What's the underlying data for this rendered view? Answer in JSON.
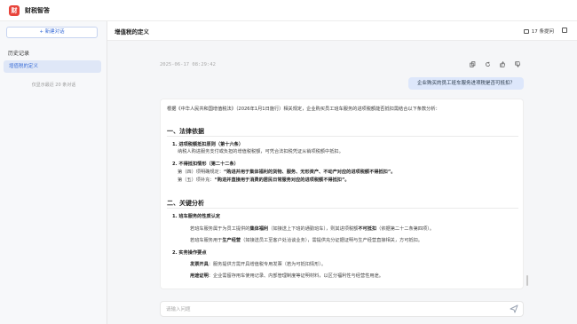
{
  "app": {
    "logo_text": "财",
    "title": "财税智答"
  },
  "sidebar": {
    "new_chat_label": "+ 新建对话",
    "history_title": "历史记录",
    "items": [
      {
        "label": "增值税的定义"
      }
    ],
    "history_note": "仅显示最近 20 条对话"
  },
  "header": {
    "title": "增值税的定义",
    "message_count": "17 条提问"
  },
  "chat": {
    "timestamp": "2025-06-17 08:29:42",
    "user_question": "企业购买的员工班车服务进项税是否可抵扣？",
    "answer": {
      "intro": "根据《中华人民共和国增值税法》（2026年1月1日施行）相关规定，企业购买员工班车服务的进项税额能否抵扣需结合以下条款分析：",
      "section1_title": "一、法律依据",
      "s1_item1_title": "1. 进项税额抵扣原则（第十六条）",
      "s1_item1_text": "纳税人购进服务支付或负担的增值税税额，可凭合法扣税凭证从销项税额中抵扣。",
      "s1_item2_title": "2. 不得抵扣情形（第二十二条）",
      "s1_item2_line1_pre": "第（四）项明确规定：",
      "s1_item2_line1_bold": "“购进并用于集体福利的货物、服务、无形资产、不动产对应的进项税额不得抵扣”。",
      "s1_item2_line2_pre": "第（五）项补充：",
      "s1_item2_line2_bold": "“购进并直接用于消费的居民日常服务对应的进项税额不得抵扣”。",
      "section2_title": "二、关键分析",
      "s2_item1_title": "1. 班车服务的性质认定",
      "s2_item1_line1_pre": "若班车服务属于为员工提供的",
      "s2_item1_line1_bold1": "集体福利",
      "s2_item1_line1_mid": "（如接送上下班的通勤班车），则其进项税额",
      "s2_item1_line1_bold2": "不可抵扣",
      "s2_item1_line1_post": "（依据第二十二条第四项）。",
      "s2_item1_line2_pre": "若班车服务用于",
      "s2_item1_line2_bold": "生产经营",
      "s2_item1_line2_post": "（如接送员工至客户处洽谈业务），需提供充分证据证明与生产经营直接相关，方可抵扣。",
      "s2_item2_title": "2. 实务操作要点",
      "s2_item2_line1_bold": "发票开具",
      "s2_item2_line1_post": "：服务提供方需开具增值税专用发票（若为可抵扣情形）。",
      "s2_item2_line2_bold": "用途证明",
      "s2_item2_line2_post": "：企业需留存用车使用记录、内部管理制度等证明材料，以区分福利性与经营性用途。"
    }
  },
  "input": {
    "placeholder": "请输入问题"
  },
  "colors": {
    "accent": "#3c6fd8",
    "brand": "#e8443b",
    "user_bubble": "#dde7fb"
  }
}
